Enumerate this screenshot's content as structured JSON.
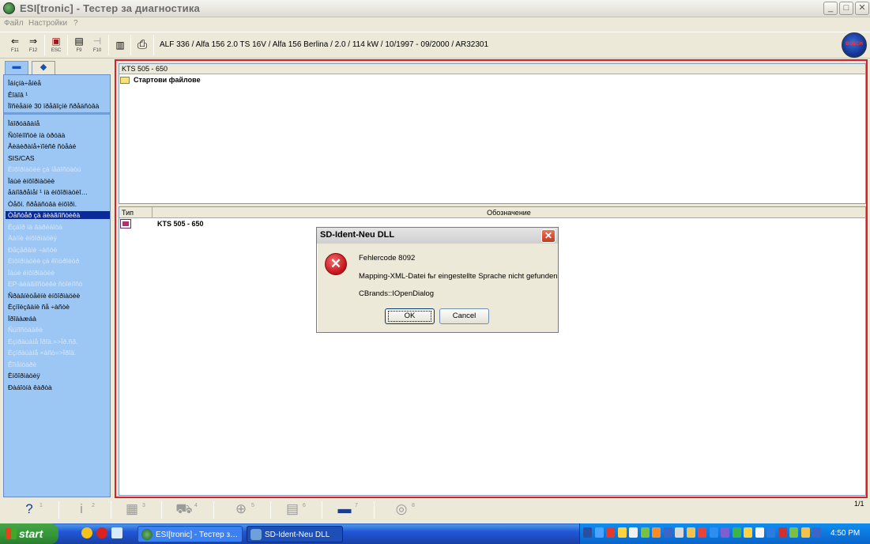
{
  "window": {
    "title": "ESI[tronic] - Тестер за диагностика",
    "controls": {
      "minimize": "_",
      "maximize": "□",
      "close": "✕"
    }
  },
  "menu": [
    "Файл",
    "Настройки",
    "?"
  ],
  "toolbar": {
    "buttons": [
      {
        "icon": "back-arrow-icon",
        "glyph": "⇐",
        "label": "F11"
      },
      {
        "icon": "forward-arrow-icon",
        "glyph": "⇒",
        "label": "F12"
      },
      {
        "icon": "escape-icon",
        "glyph": "▣",
        "label": "ESC"
      },
      {
        "icon": "f9-icon",
        "glyph": "▤",
        "label": "F9"
      },
      {
        "icon": "f10-icon",
        "glyph": "⊣",
        "label": "F10"
      },
      {
        "icon": "document-icon",
        "glyph": "▥",
        "label": ""
      },
      {
        "icon": "printer-icon",
        "glyph": "⎙",
        "label": ""
      }
    ],
    "vehicle_info": "ALF 336 / Alfa 156 2.0 TS 16V / Alfa 156 Berlina / 2.0 / 114 kW / 10/1997 - 09/2000 / AR32301",
    "brand_logo_text": "BOSCH"
  },
  "sidebar": {
    "tabs": [
      "car-tab",
      "tools-tab"
    ],
    "group1": [
      {
        "label": "Îáíçíà÷åíèå",
        "state": "enabled"
      },
      {
        "label": "Êîäîâ ¹",
        "state": "enabled"
      },
      {
        "label": "Ïîñëåäíè 30 ïðåâîçíè ñðåäñòâà",
        "state": "enabled"
      }
    ],
    "group2": [
      {
        "label": "Îáîðóäâàíå",
        "state": "enabled"
      },
      {
        "label": "Ñòîéíîñòè íà òðóäà",
        "state": "enabled"
      },
      {
        "label": "Âèäèðàíå+ïîèñê ñòåáé",
        "state": "enabled"
      },
      {
        "label": "SIS/CAS",
        "state": "enabled"
      },
      {
        "label": "Èíôîðìàöèè çà íåäîñòàòú",
        "state": "disabled"
      },
      {
        "label": "Îáùè èíôîðìàöèè",
        "state": "enabled"
      },
      {
        "label": "åäíîâðåìåí ¹ íà èíôîðìàöèî…",
        "state": "enabled"
      },
      {
        "label": "Òåõí. ñðåäñòâà èíôîðì.",
        "state": "enabled"
      },
      {
        "label": "Òåñòåð çà äèàãíîñòèêà",
        "state": "selected"
      },
      {
        "label": "Èçáîð íà âàðèàíòà",
        "state": "disabled"
      },
      {
        "label": "Äàííè èíôîðìàöèÿ",
        "state": "disabled"
      },
      {
        "label": "Ðåçåðâíè ÷àñòè",
        "state": "disabled"
      },
      {
        "label": "Èíôîðìàöèè çà êîíòðîëòð",
        "state": "disabled"
      },
      {
        "label": "Îáùè èíôîðìàöèè",
        "state": "disabled"
      },
      {
        "label": "EP-äèàãíîñòèêè ñòîéíîñò",
        "state": "disabled"
      },
      {
        "label": "Ñðàâíèòåëíè èíôîðìàöèè",
        "state": "enabled"
      },
      {
        "label": "Èçïîëçâàíè ñå ÷àñòè",
        "state": "enabled"
      },
      {
        "label": "Ïðîäàæáà",
        "state": "enabled"
      },
      {
        "label": "Ñúïîñòàâêè",
        "state": "disabled"
      },
      {
        "label": "Èçïðàùàíå Ïðîä.=>Ïð.ñð.",
        "state": "disabled"
      },
      {
        "label": "Èçïðàùàíå ×àñò=>Ïðîä.",
        "state": "disabled"
      },
      {
        "label": "Êîìåíòàðè",
        "state": "disabled"
      },
      {
        "label": "Èíôîðìàöèÿ",
        "state": "enabled"
      },
      {
        "label": "Ðàáîòíà êàðòà",
        "state": "enabled"
      }
    ]
  },
  "upper_panel": {
    "header": "KTS 505 - 650",
    "folder": "Стартови файлове"
  },
  "lower_panel": {
    "columns": [
      "Тип",
      "Обозначение"
    ],
    "rows": [
      {
        "name": "KTS 505 - 650"
      }
    ]
  },
  "dialog": {
    "title": "SD-Ident-Neu DLL",
    "close": "✕",
    "lines": [
      "Fehlercode  8092",
      "Mapping-XML-Datei fьr eingestellte Sprache nicht gefunden",
      "CBrands::IOpenDialog"
    ],
    "ok": "OK",
    "cancel": "Cancel",
    "error_glyph": "✕"
  },
  "function_bar": {
    "buttons": [
      {
        "icon": "help-question-icon",
        "glyph": "?",
        "num": "1",
        "active": true
      },
      {
        "icon": "info-icon",
        "glyph": "i",
        "num": "2",
        "active": false
      },
      {
        "icon": "calculator-icon",
        "glyph": "▦",
        "num": "3",
        "active": false
      },
      {
        "icon": "cart-icon",
        "glyph": "⛟",
        "num": "4",
        "active": false
      },
      {
        "icon": "zoom-icon",
        "glyph": "⊕",
        "num": "5",
        "active": false
      },
      {
        "icon": "list-icon",
        "glyph": "▤",
        "num": "6",
        "active": false
      },
      {
        "icon": "car-diagnosis-icon",
        "glyph": "▬",
        "num": "7",
        "active": true
      },
      {
        "icon": "brake-disc-icon",
        "glyph": "◎",
        "num": "8",
        "active": false
      }
    ],
    "page_indicator": "1/1"
  },
  "taskbar": {
    "start": "start",
    "tasks": [
      {
        "label": "ESI[tronic] - Тестер з…"
      },
      {
        "label": "SD-Ident-Neu DLL"
      }
    ],
    "clock": "4:50 PM"
  }
}
